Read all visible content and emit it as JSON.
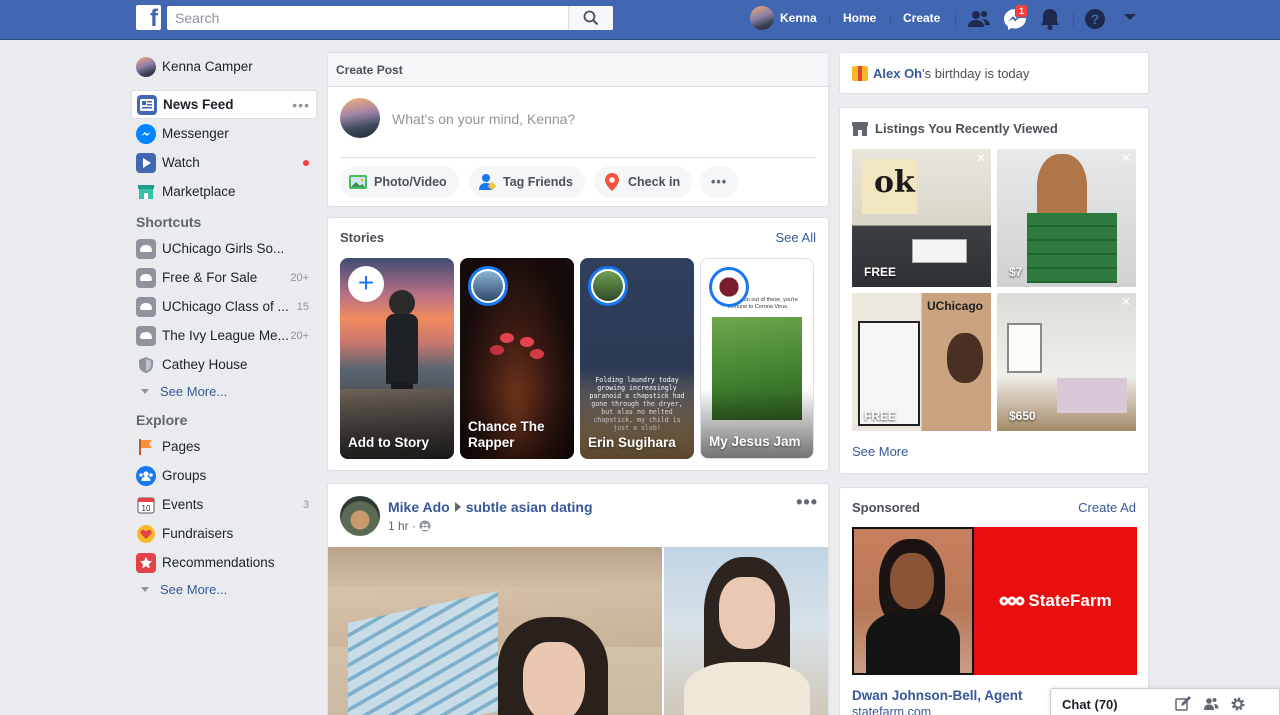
{
  "header": {
    "logo": "f",
    "search_placeholder": "Search",
    "user_name": "Kenna",
    "home_label": "Home",
    "create_label": "Create",
    "messages_badge": "1"
  },
  "left_nav": {
    "profile_name": "Kenna Camper",
    "main_items": [
      {
        "label": "News Feed",
        "icon": "news-feed-icon"
      },
      {
        "label": "Messenger",
        "icon": "messenger-icon"
      },
      {
        "label": "Watch",
        "icon": "watch-icon"
      },
      {
        "label": "Marketplace",
        "icon": "marketplace-icon"
      }
    ],
    "shortcuts_heading": "Shortcuts",
    "shortcuts": [
      {
        "label": "UChicago Girls So...",
        "count": ""
      },
      {
        "label": "Free & For Sale",
        "count": "20+"
      },
      {
        "label": "UChicago Class of ...",
        "count": "15"
      },
      {
        "label": "The Ivy League Me...",
        "count": "20+"
      },
      {
        "label": "Cathey House",
        "count": ""
      }
    ],
    "see_more_label": "See More...",
    "explore_heading": "Explore",
    "explore": [
      {
        "label": "Pages",
        "count": ""
      },
      {
        "label": "Groups",
        "count": ""
      },
      {
        "label": "Events",
        "count": "3"
      },
      {
        "label": "Fundraisers",
        "count": ""
      },
      {
        "label": "Recommendations",
        "count": ""
      }
    ],
    "explore_see_more": "See More..."
  },
  "create_post": {
    "title": "Create Post",
    "placeholder": "What's on your mind, Kenna?",
    "actions": [
      "Photo/Video",
      "Tag Friends",
      "Check in"
    ]
  },
  "stories": {
    "title": "Stories",
    "see_all": "See All",
    "items": [
      {
        "name": "Add to Story"
      },
      {
        "name": "Chance The Rapper"
      },
      {
        "name": "Erin Sugihara",
        "text": "Folding laundry today growing increasingly paranoid a chapstick had gone through the dryer, but alas no melted chapstick, my child is just a slob!"
      },
      {
        "name": "My Jesus Jam",
        "text": "You can't run out of these, you're immune to Corona Virus."
      }
    ]
  },
  "post": {
    "author": "Mike Ado",
    "group": "subtle asian dating",
    "time": "1 hr ·"
  },
  "birthday": {
    "name": "Alex Oh",
    "suffix": "'s birthday is today"
  },
  "listings": {
    "title": "Listings You Recently Viewed",
    "items": [
      {
        "price": "FREE"
      },
      {
        "price": "$7"
      },
      {
        "price": "FREE"
      },
      {
        "price": "$650"
      }
    ],
    "see_more": "See More"
  },
  "sponsored": {
    "title": "Sponsored",
    "create_ad": "Create Ad",
    "brand": "StateFarm",
    "ad_name": "Dwan Johnson-Bell, Agent",
    "ad_url": "statefarm.com"
  },
  "chat": {
    "label": "Chat (70)"
  },
  "colors": {
    "brand_blue": "#4267b2",
    "link_blue": "#385898",
    "background": "#e9ebee",
    "notification_red": "#fa3e3e",
    "statefarm_red": "#ea0e0e"
  }
}
